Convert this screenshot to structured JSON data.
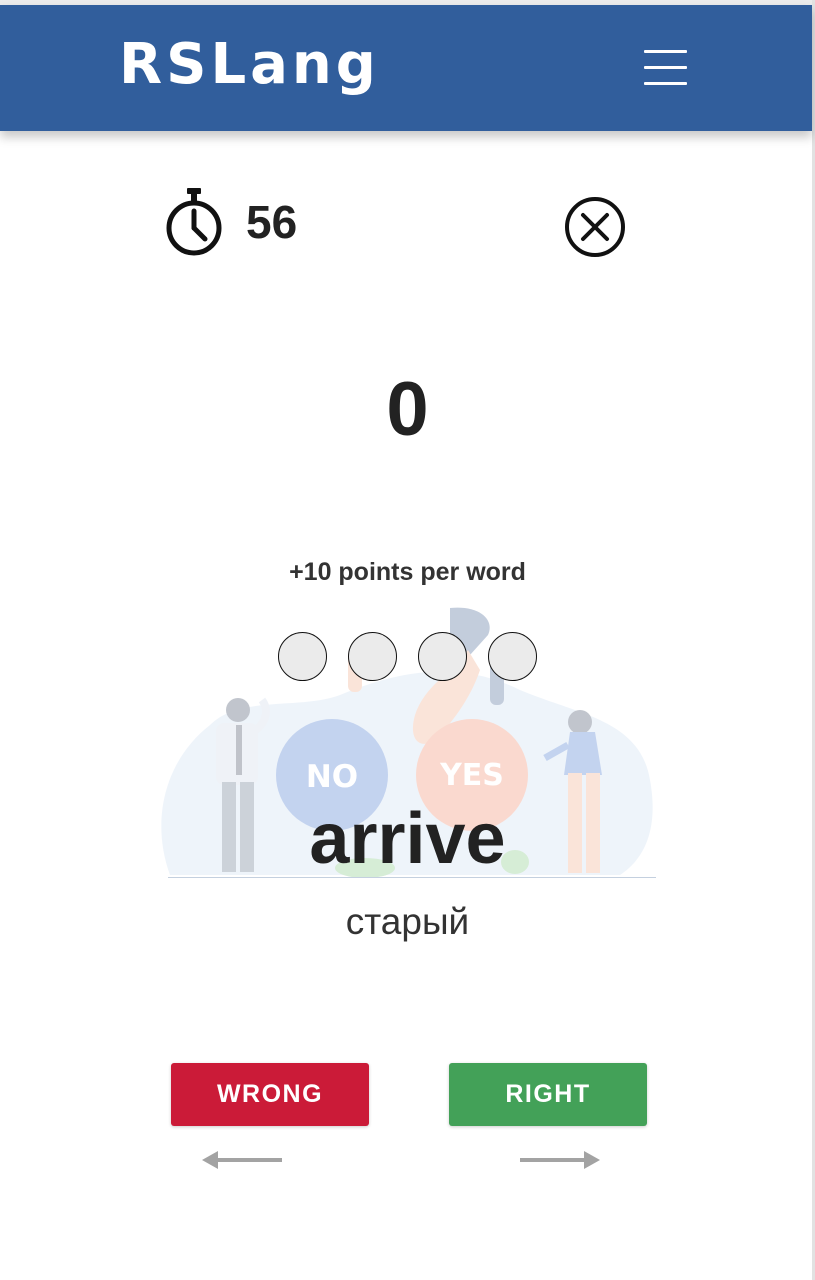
{
  "header": {
    "brand": "RSLang",
    "menu_icon": "hamburger-menu-icon",
    "background_color": "#315e9c"
  },
  "game": {
    "timer_icon": "stopwatch-icon",
    "timer_value": "56",
    "close_icon": "close-circle-icon",
    "score": "0",
    "points_text": "+10 points per word",
    "streak_dots": [
      {
        "filled": false
      },
      {
        "filled": false
      },
      {
        "filled": false
      },
      {
        "filled": false
      }
    ],
    "illustration": {
      "no_label": "NO",
      "yes_label": "YES"
    },
    "word": "arrive",
    "translation": "старый"
  },
  "controls": {
    "wrong_label": "WRONG",
    "right_label": "RIGHT",
    "wrong_color": "#cb1b38",
    "right_color": "#43a158",
    "left_arrow_icon": "arrow-left-icon",
    "right_arrow_icon": "arrow-right-icon"
  }
}
